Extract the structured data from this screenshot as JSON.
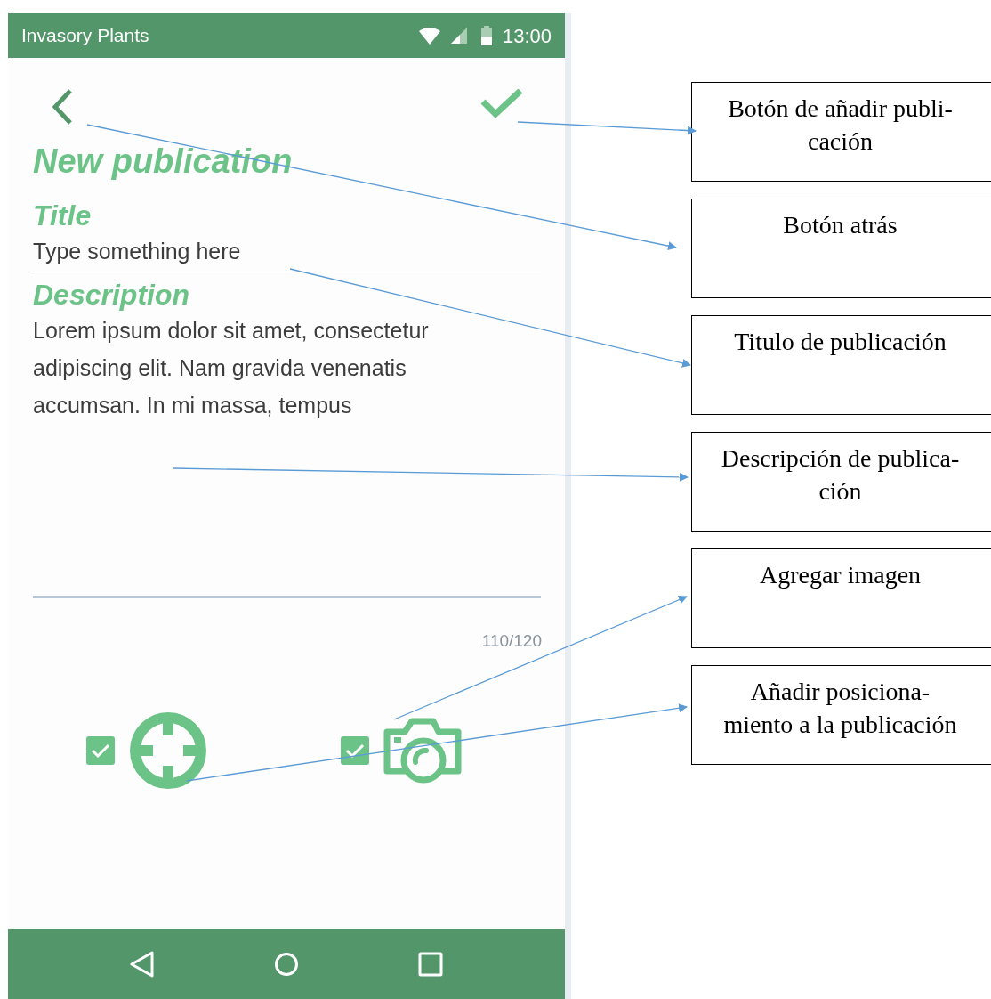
{
  "status_bar": {
    "app_name": "Invasory Plants",
    "time": "13:00"
  },
  "screen": {
    "heading": "New publication",
    "title_field": {
      "label": "Title",
      "placeholder": "Type something here"
    },
    "description_field": {
      "label": "Description",
      "value": "Lorem ipsum dolor sit amet, consectetur adipiscing elit. Nam gravida venenatis accumsan. In mi massa, tempus",
      "counter": "110/120"
    },
    "options": [
      {
        "kind": "location",
        "checked": true
      },
      {
        "kind": "camera",
        "checked": true
      }
    ]
  },
  "annotations": [
    {
      "lines": [
        "Botón de añadir publi-",
        "cación"
      ]
    },
    {
      "lines": [
        "Botón atrás"
      ]
    },
    {
      "lines": [
        "Titulo de publicación"
      ]
    },
    {
      "lines": [
        "Descripción de publica-",
        "ción"
      ]
    },
    {
      "lines": [
        "Agregar imagen"
      ]
    },
    {
      "lines": [
        "Añadir posiciona-",
        "miento a la publicación"
      ]
    }
  ]
}
